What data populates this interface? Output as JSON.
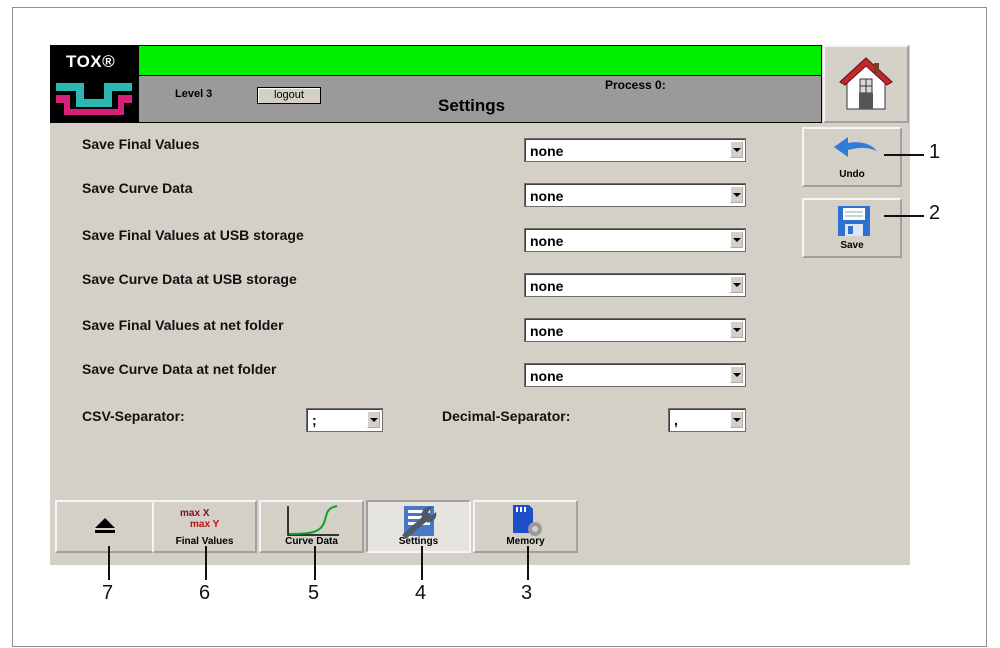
{
  "header": {
    "logo_text": "TOX®",
    "level": "Level 3",
    "logout_label": "logout",
    "process": "Process 0:",
    "title": "Settings",
    "status_color": "#00ee00"
  },
  "settings": {
    "rows": [
      {
        "label": "Save Final Values",
        "value": "none"
      },
      {
        "label": "Save Curve Data",
        "value": "none"
      },
      {
        "label": "Save Final Values at USB storage",
        "value": "none"
      },
      {
        "label": "Save Curve Data at USB storage",
        "value": "none"
      },
      {
        "label": "Save Final Values at net folder",
        "value": "none"
      },
      {
        "label": "Save Curve Data at net folder",
        "value": "none"
      }
    ],
    "csv_label": "CSV-Separator:",
    "csv_value": ";",
    "decimal_label": "Decimal-Separator:",
    "decimal_value": ","
  },
  "side_buttons": {
    "undo_label": "Undo",
    "save_label": "Save"
  },
  "tabs": {
    "max_x": "max X",
    "max_y": "max Y",
    "final_values": "Final Values",
    "curve_data": "Curve Data",
    "settings": "Settings",
    "memory": "Memory"
  },
  "callouts": [
    "1",
    "2",
    "3",
    "4",
    "5",
    "6",
    "7"
  ],
  "icons": {
    "home": "home-icon",
    "undo": "undo-arrow-icon",
    "save": "floppy-disk-icon",
    "eject": "eject-icon",
    "curve": "curve-chart-icon",
    "settings": "wrench-settings-icon",
    "memory": "memory-card-icon"
  }
}
